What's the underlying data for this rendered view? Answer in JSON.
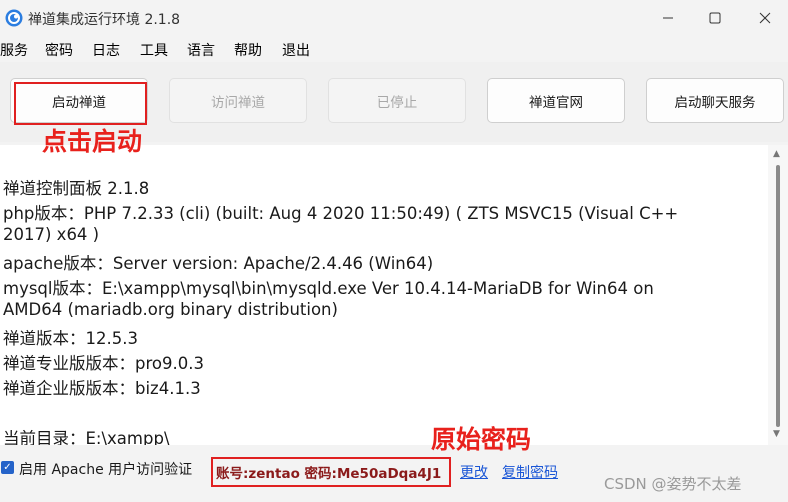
{
  "window": {
    "title": "禅道集成运行环境 2.1.8",
    "min_icon": "minimize-icon",
    "max_icon": "maximize-icon",
    "close_icon": "close-icon"
  },
  "menu": [
    "服务",
    "密码",
    "日志",
    "工具",
    "语言",
    "帮助",
    "退出"
  ],
  "toolbar": {
    "buttons": [
      {
        "label": "启动禅道",
        "enabled": true
      },
      {
        "label": "访问禅道",
        "enabled": false
      },
      {
        "label": "已停止",
        "enabled": false
      },
      {
        "label": "禅道官网",
        "enabled": true
      },
      {
        "label": "启动聊天服务",
        "enabled": true
      }
    ]
  },
  "annotations": {
    "start": "点击启动",
    "password": "原始密码"
  },
  "console": {
    "lines": [
      "禅道控制面板 2.1.8",
      "php版本：PHP 7.2.33 (cli) (built: Aug  4 2020 11:50:49) ( ZTS MSVC15 (Visual C++",
      "2017) x64 )",
      "apache版本：Server version: Apache/2.4.46 (Win64)",
      "mysql版本：E:\\xampp\\mysql\\bin\\mysqld.exe  Ver 10.4.14-MariaDB for Win64 on",
      "AMD64 (mariadb.org binary distribution)",
      "禅道版本：12.5.3",
      "禅道专业版版本：pro9.0.3",
      "禅道企业版版本：biz4.1.3",
      "",
      "当前目录：E:\\xampp\\"
    ]
  },
  "bottom": {
    "checkbox_checked": true,
    "checkbox_label": "启用 Apache 用户访问验证",
    "account_text": "账号:zentao 密码:Me50aDqa4J1",
    "link_change": "更改",
    "link_copy": "复制密码",
    "watermark": "CSDN @姿势不太差"
  },
  "colors": {
    "annotation_red": "#e8211c",
    "account_text": "#8b1a1a",
    "link_blue": "#1a56d6",
    "checkbox_blue": "#2563c9"
  }
}
